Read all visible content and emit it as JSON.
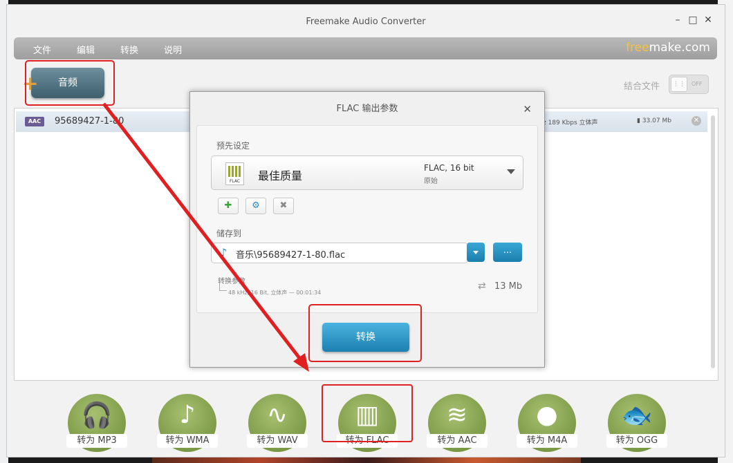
{
  "window": {
    "title": "Freemake Audio Converter",
    "controls": [
      "–",
      "□",
      "✕"
    ]
  },
  "menu": {
    "items": [
      "文件",
      "编辑",
      "转换",
      "说明"
    ],
    "brand_left": "free",
    "brand_right": "make.com"
  },
  "toolbar": {
    "audio_button": "音频",
    "merge_label": "结合文件",
    "merge_toggle": "OFF"
  },
  "file": {
    "badge": "AAC",
    "name": "95689427-1-80",
    "info": "z  189 Kbps  立体声",
    "size": "33.07 Mb"
  },
  "dialog": {
    "title": "FLAC 输出参数",
    "preset_label": "预先设定",
    "preset_name": "最佳质量",
    "preset_format": "FLAC, 16 bit",
    "preset_sub": "原始",
    "preset_icon_text": "FLAC",
    "save_label": "储存到",
    "save_path": "音乐\\95689427-1-80.flac",
    "browse": "...",
    "params_label": "转换参数",
    "params_value": "48 kHz, 16 Bit, 立体声 — 00:01:34",
    "size": "13 Mb",
    "convert": "转换"
  },
  "formats": [
    {
      "label": "转为 MP3",
      "icon": "headphones-icon"
    },
    {
      "label": "转为 WMA",
      "icon": "windows-media-icon"
    },
    {
      "label": "转为 WAV",
      "icon": "waveform-icon"
    },
    {
      "label": "转为 FLAC",
      "icon": "equalizer-icon"
    },
    {
      "label": "转为 AAC",
      "icon": "aac-wave-icon"
    },
    {
      "label": "转为 M4A",
      "icon": "apple-icon"
    },
    {
      "label": "转为 OGG",
      "icon": "fish-icon"
    }
  ],
  "colors": {
    "accent_blue": "#1c80b0",
    "format_green": "#6a8a35",
    "annotation_red": "#e02020",
    "brand_yellow": "#f5c33b"
  }
}
